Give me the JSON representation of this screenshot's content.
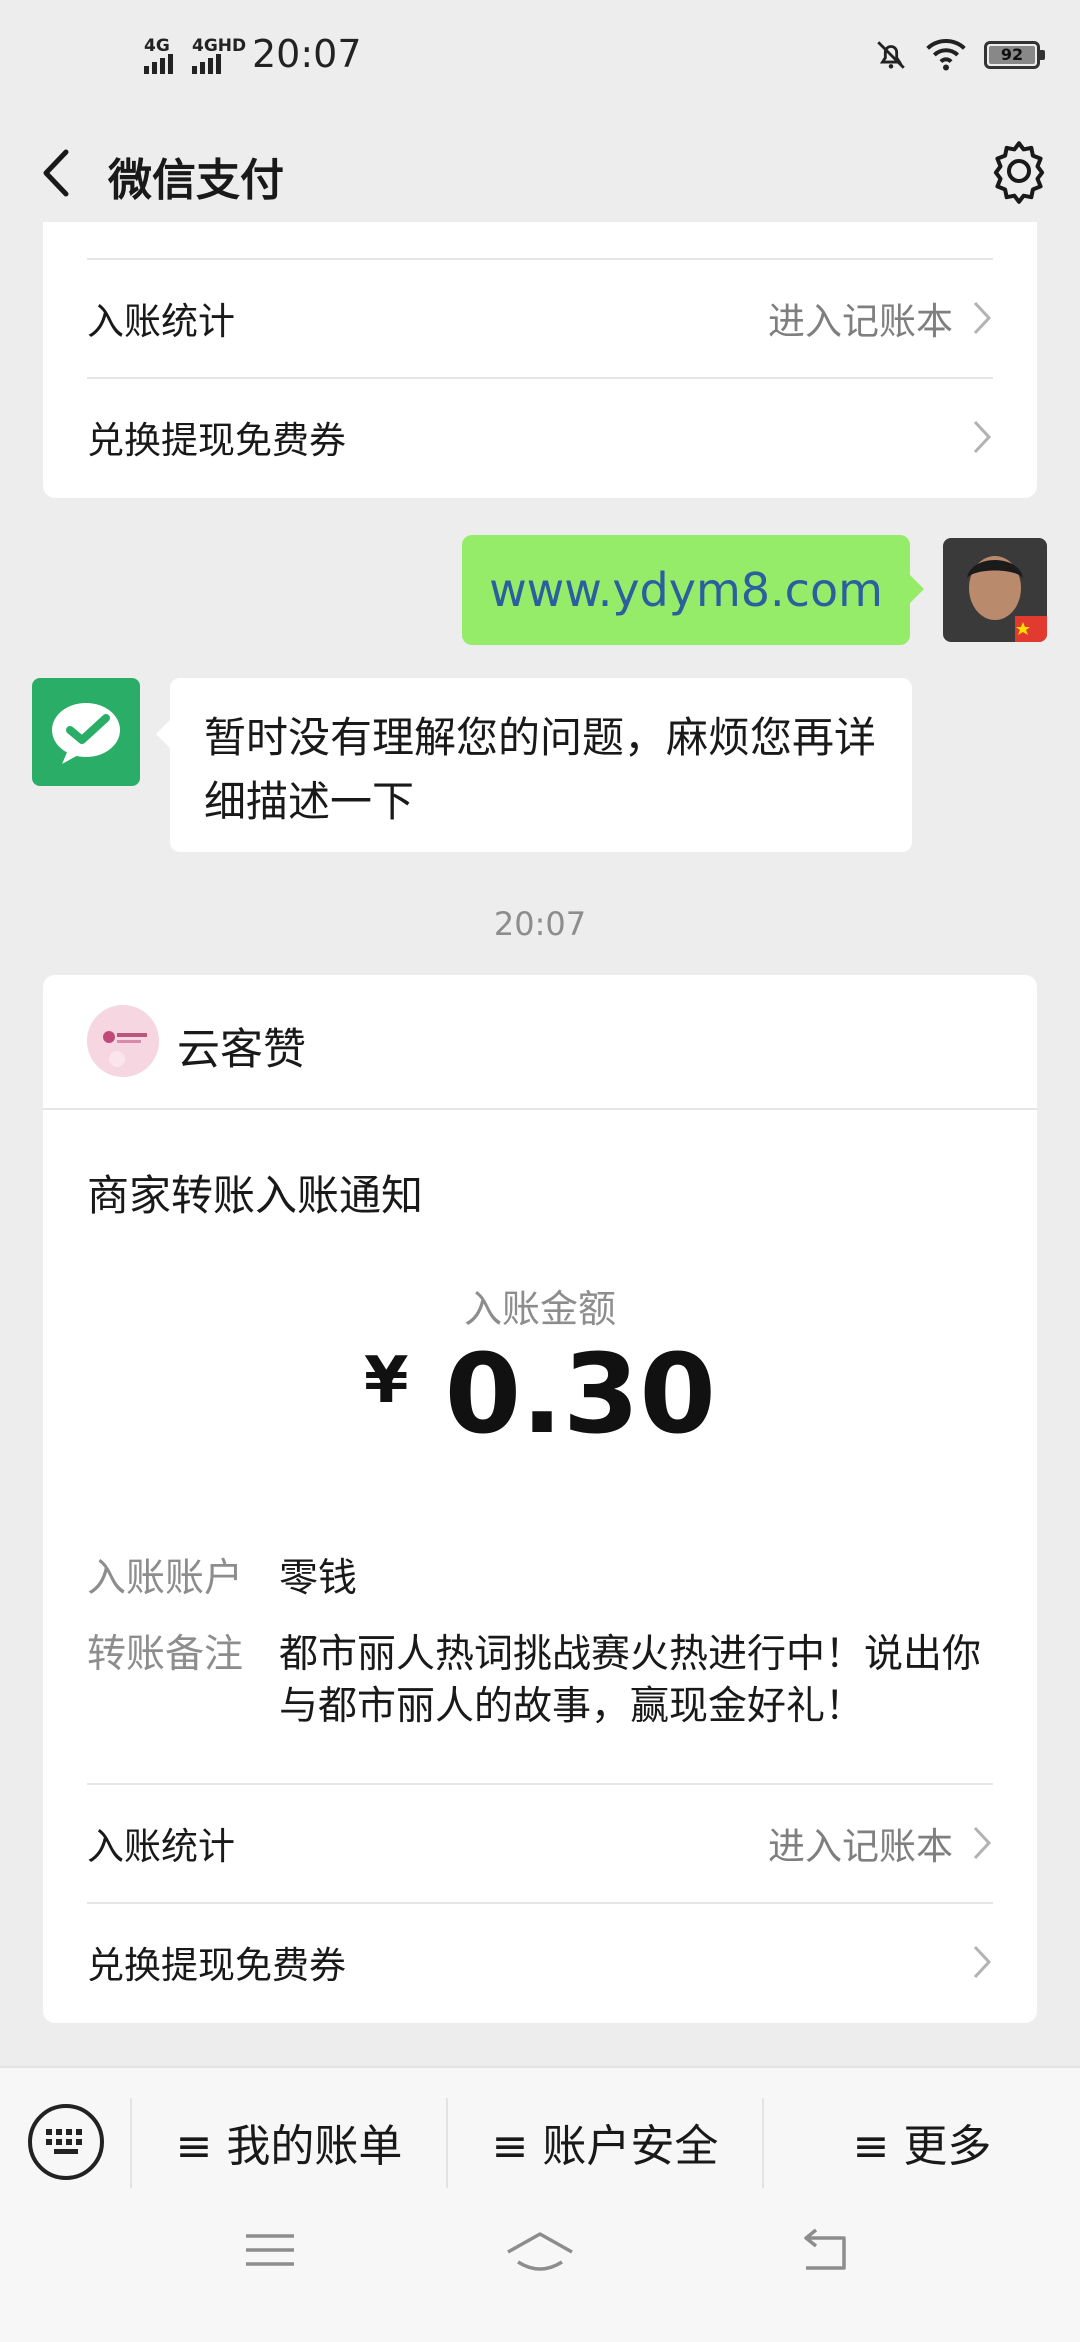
{
  "status_bar": {
    "signal_1_label": "4G",
    "signal_2_label": "4GHD",
    "time": "20:07",
    "battery": "92"
  },
  "nav": {
    "title": "微信支付"
  },
  "top_card": {
    "rows": [
      {
        "label": "入账统计",
        "right_text": "进入记账本"
      },
      {
        "label": "兑换提现免费券",
        "right_text": ""
      }
    ]
  },
  "chat": {
    "user_message": "www.ydym8.com",
    "bot_message": "暂时没有理解您的问题，麻烦您再详细描述一下",
    "timestamp": "20:07"
  },
  "notice_card": {
    "merchant_name": "云客赞",
    "title": "商家转账入账通知",
    "amount_label": "入账金额",
    "currency": "¥",
    "amount": "0.30",
    "account_label": "入账账户",
    "account_value": "零钱",
    "note_label": "转账备注",
    "note_value": "都市丽人热词挑战赛火热进行中！说出你与都市丽人的故事，赢现金好礼！",
    "rows": [
      {
        "label": "入账统计",
        "right_text": "进入记账本"
      },
      {
        "label": "兑换提现免费券",
        "right_text": ""
      }
    ]
  },
  "bottom_menu": {
    "items": [
      "≡ 我的账单",
      "≡ 账户安全",
      "≡ 更多"
    ]
  },
  "colors": {
    "background": "#ededed",
    "user_bubble": "#95ec69",
    "bot_avatar": "#2aae67",
    "link": "#2b5f9e"
  }
}
